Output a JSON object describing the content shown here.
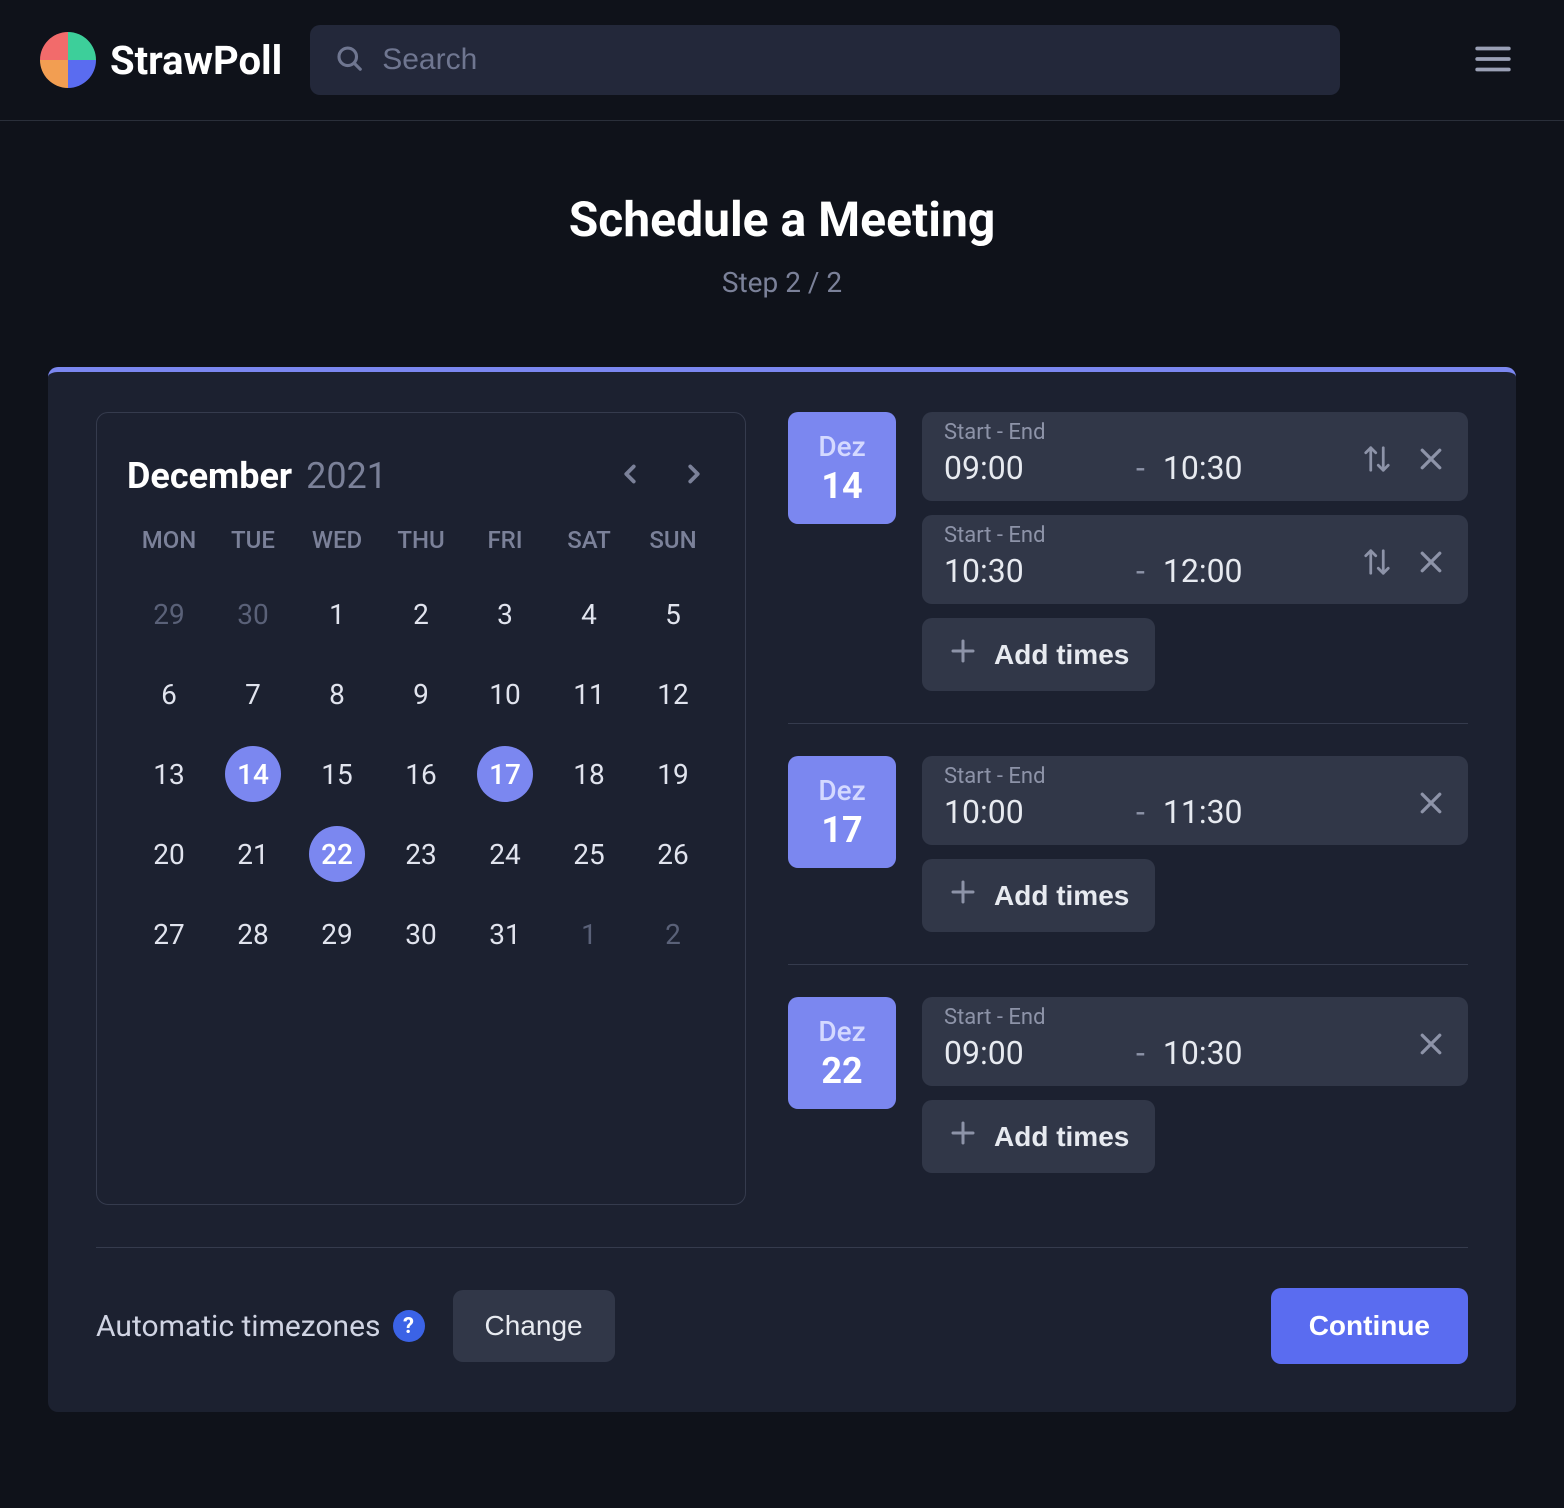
{
  "header": {
    "brand": "StrawPoll",
    "search_placeholder": "Search"
  },
  "page": {
    "title": "Schedule a Meeting",
    "step": "Step 2 / 2"
  },
  "calendar": {
    "month": "December",
    "year": "2021",
    "dow": [
      "MON",
      "TUE",
      "WED",
      "THU",
      "FRI",
      "SAT",
      "SUN"
    ],
    "days": [
      {
        "n": "29",
        "muted": true
      },
      {
        "n": "30",
        "muted": true
      },
      {
        "n": "1"
      },
      {
        "n": "2"
      },
      {
        "n": "3"
      },
      {
        "n": "4"
      },
      {
        "n": "5"
      },
      {
        "n": "6"
      },
      {
        "n": "7"
      },
      {
        "n": "8"
      },
      {
        "n": "9"
      },
      {
        "n": "10"
      },
      {
        "n": "11"
      },
      {
        "n": "12"
      },
      {
        "n": "13"
      },
      {
        "n": "14",
        "selected": true
      },
      {
        "n": "15"
      },
      {
        "n": "16"
      },
      {
        "n": "17",
        "selected": true
      },
      {
        "n": "18"
      },
      {
        "n": "19"
      },
      {
        "n": "20"
      },
      {
        "n": "21"
      },
      {
        "n": "22",
        "selected": true
      },
      {
        "n": "23"
      },
      {
        "n": "24"
      },
      {
        "n": "25"
      },
      {
        "n": "26"
      },
      {
        "n": "27"
      },
      {
        "n": "28"
      },
      {
        "n": "29"
      },
      {
        "n": "30"
      },
      {
        "n": "31"
      },
      {
        "n": "1",
        "muted": true
      },
      {
        "n": "2",
        "muted": true
      }
    ]
  },
  "labels": {
    "start_end": "Start - End",
    "add_times": "Add times"
  },
  "dates": [
    {
      "month_short": "Dez",
      "day": "14",
      "slots": [
        {
          "start": "09:00",
          "end": "10:30",
          "repeat": true
        },
        {
          "start": "10:30",
          "end": "12:00",
          "repeat": true
        }
      ]
    },
    {
      "month_short": "Dez",
      "day": "17",
      "slots": [
        {
          "start": "10:00",
          "end": "11:30",
          "repeat": false
        }
      ]
    },
    {
      "month_short": "Dez",
      "day": "22",
      "slots": [
        {
          "start": "09:00",
          "end": "10:30",
          "repeat": false
        }
      ]
    }
  ],
  "footer": {
    "timezone_label": "Automatic timezones",
    "help": "?",
    "change": "Change",
    "continue": "Continue"
  }
}
